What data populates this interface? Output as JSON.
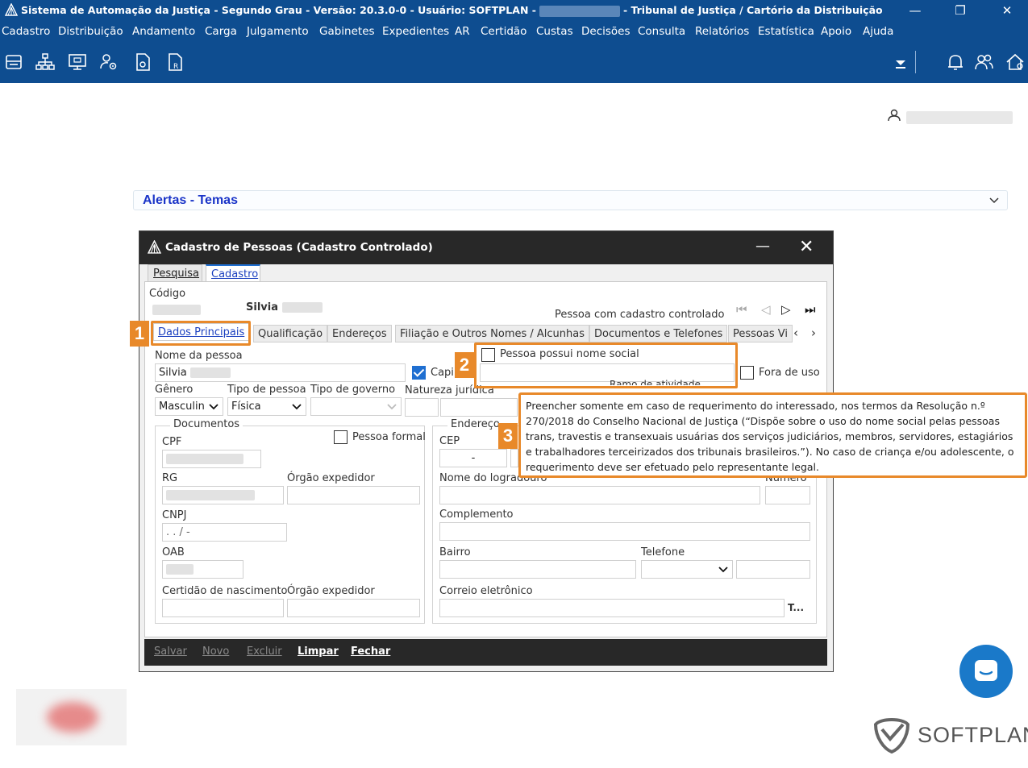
{
  "window": {
    "title_prefix": "Sistema de Automação da Justiça - Segundo Grau - Versão: 20.3.0-0 - Usuário: SOFTPLAN -",
    "title_suffix": "- Tribunal de Justiça / Cartório da Distribuição",
    "minimize": "—",
    "restore": "❐",
    "close": "✕"
  },
  "menu": [
    "Cadastro",
    "Distribuição",
    "Andamento",
    "Carga",
    "Julgamento",
    "Gabinetes",
    "Expedientes",
    "AR",
    "Certidão",
    "Custas",
    "Decisões",
    "Consulta",
    "Relatórios",
    "Estatística",
    "Apoio",
    "Ajuda"
  ],
  "toolbar": {
    "icons": [
      "printer-icon",
      "org-chart-icon",
      "monitor-icon",
      "user-settings-icon",
      "document-icon",
      "document-r-icon"
    ],
    "right_icons": [
      "dropdown-filter-icon",
      "bell-icon",
      "users-icon",
      "home-icon"
    ]
  },
  "alerts": {
    "title": "Alertas - Temas"
  },
  "dialog": {
    "title": "Cadastro de Pessoas (Cadastro Controlado)",
    "minimize": "—",
    "close": "✕",
    "outer_tabs": [
      "Pesquisa",
      "Cadastro"
    ],
    "codigo_label": "Código",
    "person_name": "Silvia",
    "controlled_note": "Pessoa com cadastro controlado",
    "nav": [
      "⏮",
      "◁",
      "▷",
      "⏭"
    ],
    "subtabs": [
      "Dados Principais",
      "Qualificação",
      "Endereços",
      "Filiação e Outros Nomes / Alcunhas",
      "Documentos e Telefones",
      "Pessoas Vi"
    ],
    "subtab_arrows": [
      "‹",
      "›"
    ],
    "nome_label": "Nome da pessoa",
    "nome_value": "Silvia",
    "capitalize_label": "Capi",
    "social_name_label": "Pessoa possui nome social",
    "fora_de_uso_label": "Fora de uso",
    "genero_label": "Gênero",
    "genero_value": "Masculin",
    "tipo_pessoa_label": "Tipo de pessoa",
    "tipo_pessoa_value": "Física",
    "tipo_governo_label": "Tipo de governo",
    "natureza_label": "Natureza jurídica",
    "ramo_label": "Ramo de atividade",
    "documentos_title": "Documentos",
    "pessoa_formal_label": "Pessoa formal",
    "cpf_label": "CPF",
    "rg_label": "RG",
    "orgao_label": "Órgão expedidor",
    "cnpj_label": "CNPJ",
    "cnpj_mask": ". . /  -",
    "oab_label": "OAB",
    "certidao_label": "Certidão de nascimento",
    "orgao2_label": "Órgão expedidor",
    "endereco_title": "Endereço",
    "cep_label": "CEP",
    "cep_value": "-",
    "logradouro_label": "Nome do logradouro",
    "numero_label": "Número",
    "complemento_label": "Complemento",
    "bairro_label": "Bairro",
    "telefone_label": "Telefone",
    "email_label": "Correio eletrônico",
    "email_btn": "T...",
    "buttons": [
      "Salvar",
      "Novo",
      "Excluir",
      "Limpar",
      "Fechar"
    ]
  },
  "annotations": {
    "n1": "1",
    "n2": "2",
    "n3": "3",
    "tooltip": "Preencher somente em caso de requerimento do interessado, nos termos da Resolução n.º 270/2018 do Conselho Nacional de Justiça (“Dispõe sobre o uso do nome social pelas pessoas trans, travestis e transexuais usuárias dos serviços judiciários, membros, servidores, estagiários e trabalhadores terceirizados dos tribunais brasileiros.”). No caso de criança e/ou adolescente, o requerimento deve ser efetuado pelo representante legal."
  },
  "brand": {
    "name": "SOFTPLAN"
  },
  "colors": {
    "chrome": "#0e4d90",
    "dialog_bar": "#282828",
    "accent": "#e8892a",
    "link": "#1a34c8"
  }
}
